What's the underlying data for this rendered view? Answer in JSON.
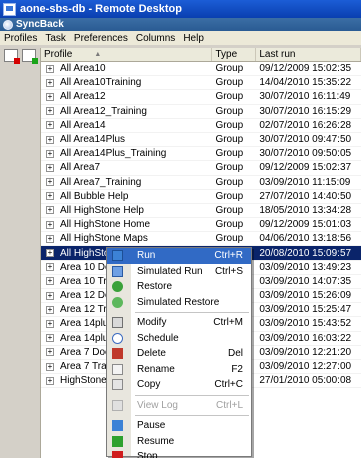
{
  "remote_desktop": {
    "title": "aone-sbs-db - Remote Desktop"
  },
  "app": {
    "title": "SyncBack"
  },
  "menubar": [
    "Profiles",
    "Task",
    "Preferences",
    "Columns",
    "Help"
  ],
  "grid": {
    "headers": {
      "profile": "Profile",
      "type": "Type",
      "last_run": "Last run",
      "sort_arrow": "▲"
    },
    "rows": [
      {
        "name": "All Area10",
        "type": "Group",
        "last_run": "09/12/2009 15:02:35"
      },
      {
        "name": "All Area10Training",
        "type": "Group",
        "last_run": "14/04/2010 15:35:22"
      },
      {
        "name": "All Area12",
        "type": "Group",
        "last_run": "30/07/2010 16:11:49"
      },
      {
        "name": "All Area12_Training",
        "type": "Group",
        "last_run": "30/07/2010 16:15:29"
      },
      {
        "name": "All Area14",
        "type": "Group",
        "last_run": "02/07/2010 16:26:28"
      },
      {
        "name": "All Area14Plus",
        "type": "Group",
        "last_run": "30/07/2010 09:47:50"
      },
      {
        "name": "All Area14Plus_Training",
        "type": "Group",
        "last_run": "30/07/2010 09:50:05"
      },
      {
        "name": "All Area7",
        "type": "Group",
        "last_run": "09/12/2009 15:02:37"
      },
      {
        "name": "All Area7_Training",
        "type": "Group",
        "last_run": "03/09/2010 11:15:09"
      },
      {
        "name": "All Bubble Help",
        "type": "Group",
        "last_run": "27/07/2010 14:40:50"
      },
      {
        "name": "All HighStone Help",
        "type": "Group",
        "last_run": "18/05/2010 13:34:28"
      },
      {
        "name": "All HighStone Home",
        "type": "Group",
        "last_run": "09/12/2009 15:01:03"
      },
      {
        "name": "All HighStone Maps",
        "type": "Group",
        "last_run": "04/06/2010 13:18:56"
      },
      {
        "name": "All HighStoneUpgrade",
        "type": "Group",
        "last_run": "20/08/2010 15:09:57",
        "selected": true
      },
      {
        "name": "Area 10 Doc Template",
        "type": "",
        "last_run": "03/09/2010 13:49:23"
      },
      {
        "name": "Area 10 Training Doc",
        "type": "",
        "last_run": "03/09/2010 14:07:35"
      },
      {
        "name": "Area 12 Doc Template",
        "type": "",
        "last_run": "03/09/2010 15:26:09"
      },
      {
        "name": "Area 12 Training Doc",
        "type": "",
        "last_run": "03/09/2010 15:25:47"
      },
      {
        "name": "Area 14plus Doc Ter",
        "type": "",
        "last_run": "03/09/2010 15:43:52"
      },
      {
        "name": "Area 14plus Training",
        "type": "",
        "last_run": "03/09/2010 16:03:22"
      },
      {
        "name": "Area 7 Doc Template",
        "type": "",
        "last_run": "03/09/2010 12:21:20"
      },
      {
        "name": "Area 7 Training Doc",
        "type": "",
        "last_run": "03/09/2010 12:27:00"
      },
      {
        "name": "HighStone User Rep",
        "type": "",
        "last_run": "27/01/2010 05:00:08"
      }
    ]
  },
  "context_menu": {
    "items": [
      {
        "label": "Run",
        "shortcut": "Ctrl+R",
        "icon": "run-icon",
        "state": "highlight"
      },
      {
        "label": "Simulated Run",
        "shortcut": "Ctrl+S",
        "icon": "simulated-run-icon"
      },
      {
        "label": "Restore",
        "shortcut": "",
        "icon": "restore-icon"
      },
      {
        "label": "Simulated Restore",
        "shortcut": "",
        "icon": "simulated-restore-icon"
      },
      {
        "separator": true
      },
      {
        "label": "Modify",
        "shortcut": "Ctrl+M",
        "icon": "modify-icon"
      },
      {
        "label": "Schedule",
        "shortcut": "",
        "icon": "schedule-icon"
      },
      {
        "label": "Delete",
        "shortcut": "Del",
        "icon": "delete-icon"
      },
      {
        "label": "Rename",
        "shortcut": "F2",
        "icon": "rename-icon"
      },
      {
        "label": "Copy",
        "shortcut": "Ctrl+C",
        "icon": "copy-icon"
      },
      {
        "separator": true
      },
      {
        "label": "View Log",
        "shortcut": "Ctrl+L",
        "icon": "view-log-icon",
        "state": "disabled"
      },
      {
        "separator": true
      },
      {
        "label": "Pause",
        "shortcut": "",
        "icon": "pause-icon"
      },
      {
        "label": "Resume",
        "shortcut": "",
        "icon": "resume-icon"
      },
      {
        "label": "Stop",
        "shortcut": "",
        "icon": "stop-icon"
      }
    ]
  },
  "colors": {
    "selection": "#0a246a",
    "menu_highlight": "#316ac5",
    "titlebar": "#0a3fb0"
  }
}
